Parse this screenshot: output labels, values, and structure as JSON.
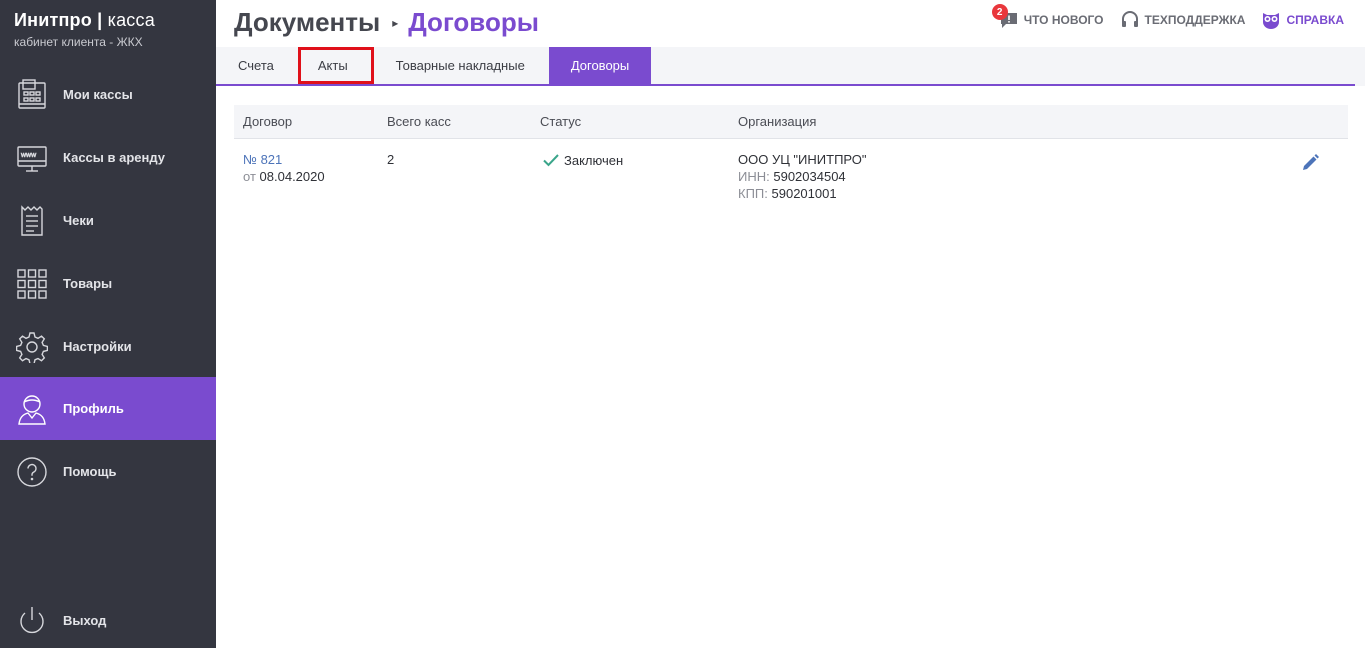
{
  "brand": {
    "name": "Инитпро",
    "separator": "|",
    "product": "касса",
    "subtitle": "кабинет клиента - ЖКХ"
  },
  "sidebar": {
    "items": [
      {
        "label": "Мои кассы",
        "icon": "cash-register-icon"
      },
      {
        "label": "Кассы в аренду",
        "icon": "web-terminal-icon"
      },
      {
        "label": "Чеки",
        "icon": "receipt-icon"
      },
      {
        "label": "Товары",
        "icon": "grid-icon"
      },
      {
        "label": "Настройки",
        "icon": "gear-icon"
      },
      {
        "label": "Профиль",
        "icon": "user-icon",
        "active": true
      },
      {
        "label": "Помощь",
        "icon": "question-icon"
      }
    ],
    "logout": {
      "label": "Выход",
      "icon": "power-icon"
    }
  },
  "header": {
    "crumb_root": "Документы",
    "crumb_separator": "▸",
    "crumb_current": "Договоры",
    "whats_new": {
      "label": "ЧТО НОВОГО",
      "badge": "2"
    },
    "support": {
      "label": "ТЕХПОДДЕРЖКА"
    },
    "help": {
      "label": "СПРАВКА"
    }
  },
  "tabs": [
    {
      "label": "Счета"
    },
    {
      "label": "Акты",
      "highlighted": true
    },
    {
      "label": "Товарные накладные"
    },
    {
      "label": "Договоры",
      "active": true
    }
  ],
  "table": {
    "columns": [
      "Договор",
      "Всего касс",
      "Статус",
      "Организация"
    ],
    "rows": [
      {
        "number_prefix": "№",
        "number": "821",
        "date_prefix": "от",
        "date": "08.04.2020",
        "total": "2",
        "status": "Заключен",
        "org_name": "ООО УЦ \"ИНИТПРО\"",
        "inn_label": "ИНН:",
        "inn": "5902034504",
        "kpp_label": "КПП:",
        "kpp": "590201001"
      }
    ]
  },
  "colors": {
    "accent": "#7a4bcf",
    "sidebar": "#343640",
    "badge": "#e9373c",
    "success": "#3aa58a",
    "link": "#4d74b9",
    "highlight": "#e0101a"
  }
}
